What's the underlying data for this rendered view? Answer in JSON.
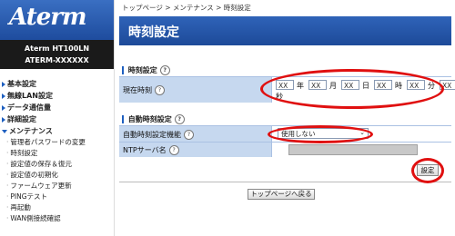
{
  "sidebar": {
    "logo": "Aterm",
    "model_line1": "Aterm   HT100LN",
    "model_line2": "ATERM-XXXXXX",
    "menu": [
      {
        "label": "基本設定",
        "open": false
      },
      {
        "label": "無線LAN設定",
        "open": false
      },
      {
        "label": "データ通信量",
        "open": false
      },
      {
        "label": "詳細設定",
        "open": false
      },
      {
        "label": "メンテナンス",
        "open": true
      }
    ],
    "sub_items": [
      "管理者パスワードの変更",
      "時刻設定",
      "設定値の保存＆復元",
      "設定値の初期化",
      "ファームウェア更新",
      "PINGテスト",
      "再起動",
      "WAN側接続確認"
    ]
  },
  "main": {
    "breadcrumb": "トップページ > メンテナンス > 時刻設定",
    "title": "時刻設定",
    "section1": {
      "label": "時刻設定",
      "row_label": "現在時刻",
      "fields": {
        "year": "XX",
        "month": "XX",
        "day": "XX",
        "hour": "XX",
        "minute": "XX",
        "second": "XX"
      },
      "units": {
        "year": "年",
        "month": "月",
        "day": "日",
        "hour": "時",
        "minute": "分",
        "second": "秒"
      }
    },
    "section2": {
      "label": "自動時刻設定",
      "sync_row_label": "自動時刻設定機能",
      "sync_value": "使用しない",
      "ntp_row_label": "NTPサーバ名"
    },
    "help_glyph": "?",
    "set_button": "設定",
    "top_button": "トップページへ戻る"
  },
  "colors": {
    "header_blue": "#1d4a99",
    "row_blue": "#c6d8ef",
    "annotation_red": "#e01010"
  }
}
